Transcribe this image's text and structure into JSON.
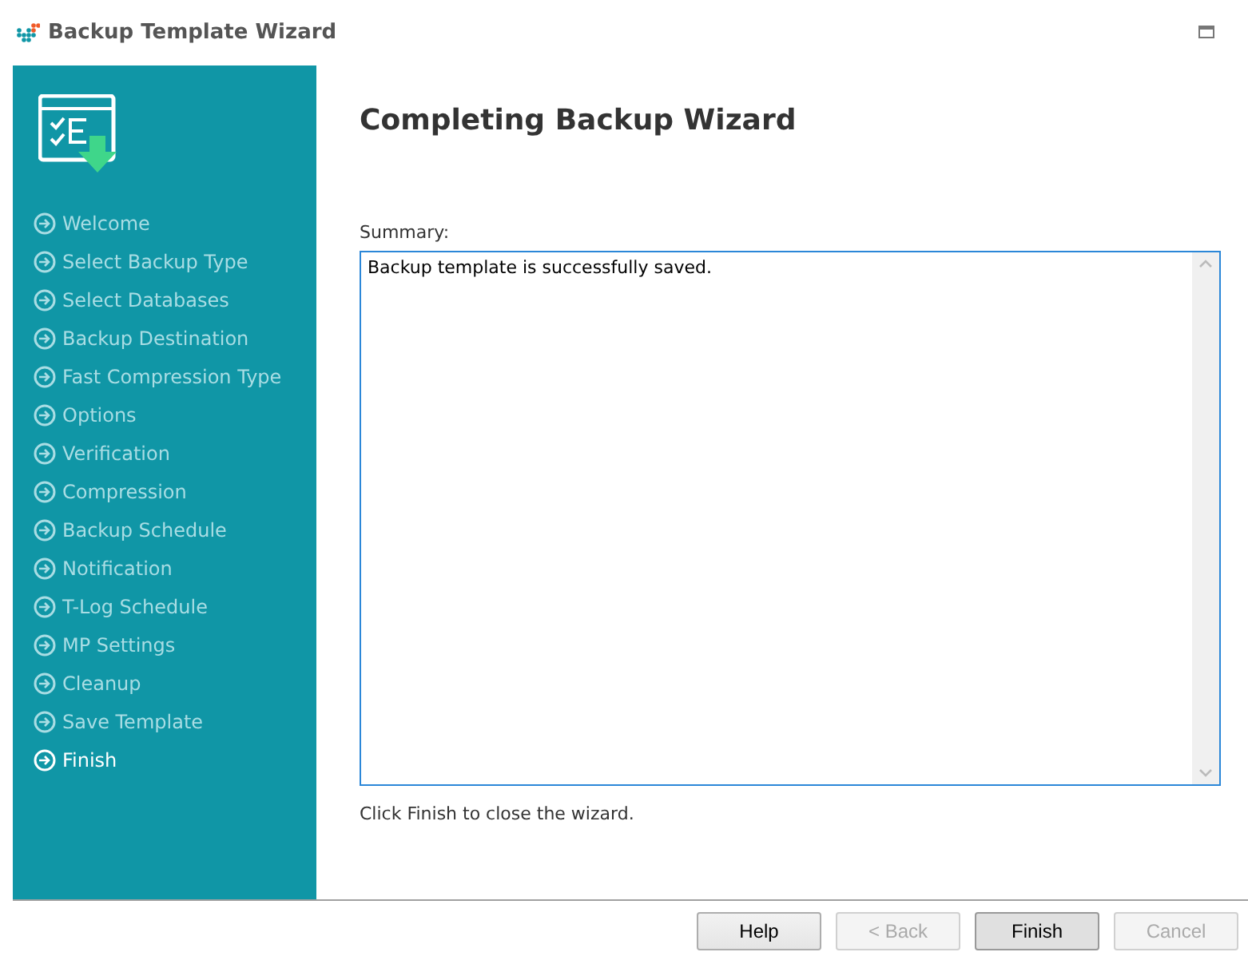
{
  "window": {
    "title": "Backup Template Wizard"
  },
  "steps": [
    {
      "label": "Welcome",
      "selected": false
    },
    {
      "label": "Select Backup Type",
      "selected": false
    },
    {
      "label": "Select Databases",
      "selected": false
    },
    {
      "label": "Backup Destination",
      "selected": false
    },
    {
      "label": "Fast Compression Type",
      "selected": false
    },
    {
      "label": "Options",
      "selected": false
    },
    {
      "label": "Verification",
      "selected": false
    },
    {
      "label": "Compression",
      "selected": false
    },
    {
      "label": "Backup Schedule",
      "selected": false
    },
    {
      "label": "Notification",
      "selected": false
    },
    {
      "label": "T-Log Schedule",
      "selected": false
    },
    {
      "label": "MP Settings",
      "selected": false
    },
    {
      "label": "Cleanup",
      "selected": false
    },
    {
      "label": "Save Template",
      "selected": false
    },
    {
      "label": "Finish",
      "selected": true
    }
  ],
  "page": {
    "heading": "Completing Backup Wizard",
    "summary_label": "Summary:",
    "summary_value": "Backup template is successfully saved.",
    "hint": "Click Finish to close the wizard."
  },
  "buttons": [
    {
      "label": "Help",
      "disabled": false,
      "default": false
    },
    {
      "label": "< Back",
      "disabled": true,
      "default": false
    },
    {
      "label": "Finish",
      "disabled": false,
      "default": true
    },
    {
      "label": "Cancel",
      "disabled": true,
      "default": false
    }
  ]
}
